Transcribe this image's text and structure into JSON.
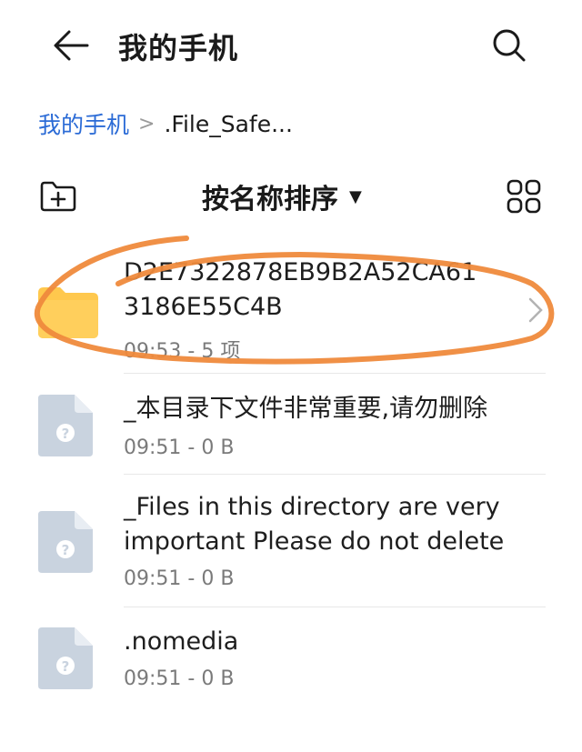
{
  "header": {
    "title": "我的手机",
    "back_icon": "back-arrow-icon",
    "search_icon": "search-icon"
  },
  "breadcrumb": {
    "root": "我的手机",
    "separator": ">",
    "current": ".File_Safe..."
  },
  "toolbar": {
    "new_folder_icon": "new-folder-icon",
    "sort_label": "按名称排序",
    "sort_caret": "▼",
    "view_icon": "grid-view-icon"
  },
  "files": [
    {
      "type": "folder",
      "name_line1": "D2E7322878EB9B2A52CA61",
      "name_line2": "3186E55C4B",
      "meta": "09:53 - 5 项"
    },
    {
      "type": "file",
      "name_line1": "_本目录下文件非常重要,请勿删除",
      "meta": "09:51 - 0 B"
    },
    {
      "type": "file",
      "name_line1": "_Files in this directory are very",
      "name_line2": "important Please do not delete",
      "meta": "09:51 - 0 B"
    },
    {
      "type": "file",
      "name_line1": ".nomedia",
      "meta": "09:51 - 0 B"
    }
  ],
  "colors": {
    "accent": "#2b6bd6",
    "folder": "#ffc84d",
    "file_icon": "#c9d3df",
    "annotation": "#ef8a3c"
  }
}
